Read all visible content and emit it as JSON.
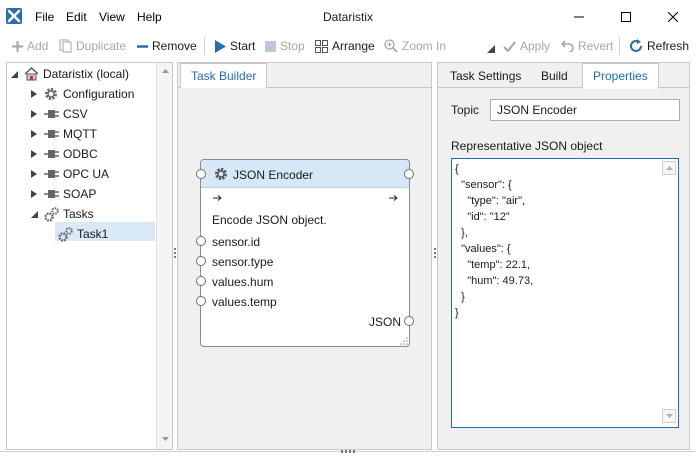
{
  "app": {
    "title": "Dataristix",
    "menu": [
      "File",
      "Edit",
      "View",
      "Help"
    ]
  },
  "toolbar": {
    "add": "Add",
    "duplicate": "Duplicate",
    "remove": "Remove",
    "start": "Start",
    "stop": "Stop",
    "arrange": "Arrange",
    "zoom_in": "Zoom In",
    "apply": "Apply",
    "revert": "Revert",
    "refresh": "Refresh"
  },
  "tree": {
    "root": "Dataristix (local)",
    "items": [
      {
        "label": "Configuration",
        "icon": "gear-icon"
      },
      {
        "label": "CSV",
        "icon": "plug-icon"
      },
      {
        "label": "MQTT",
        "icon": "plug-icon"
      },
      {
        "label": "ODBC",
        "icon": "plug-icon"
      },
      {
        "label": "OPC UA",
        "icon": "plug-icon"
      },
      {
        "label": "SOAP",
        "icon": "plug-icon"
      },
      {
        "label": "Tasks",
        "icon": "gears-icon"
      }
    ],
    "child": "Task1"
  },
  "center": {
    "tab": "Task Builder",
    "node": {
      "title": "JSON Encoder",
      "description": "Encode JSON object.",
      "inputs": [
        "sensor.id",
        "sensor.type",
        "values.hum",
        "values.temp"
      ],
      "output": "JSON"
    }
  },
  "right": {
    "tabs": [
      "Task Settings",
      "Build",
      "Properties"
    ],
    "active_tab": "Properties",
    "topic_label": "Topic",
    "topic_value": "JSON Encoder",
    "json_label": "Representative JSON object",
    "json_value": "{\n  \"sensor\": {\n    \"type\": \"air\",\n    \"id\": \"12\"\n  },\n  \"values\": {\n    \"temp\": 22.1,\n    \"hum\": 49.73,\n  }\n}"
  },
  "colors": {
    "accent": "#1e6bb8",
    "selection": "#d9e9f7",
    "node_header": "#d6e8f7",
    "app_icon": "#2b6cb0"
  }
}
